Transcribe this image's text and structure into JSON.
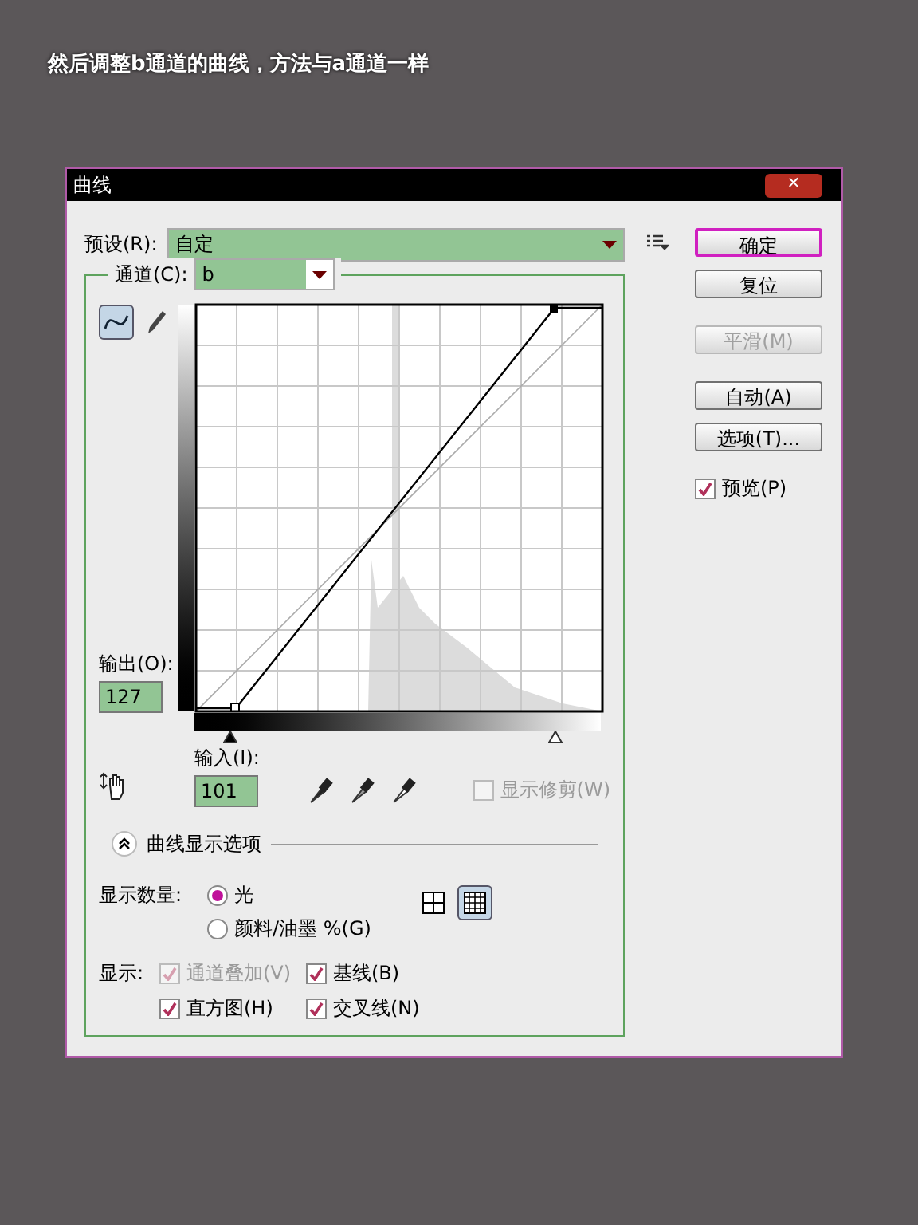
{
  "caption": "然后调整b通道的曲线，方法与a通道一样",
  "dialog": {
    "title": "曲线",
    "close": "✕",
    "preset": {
      "label": "预设(R):",
      "value": "自定"
    },
    "channel": {
      "label": "通道(C):",
      "value": "b"
    },
    "tools": [
      {
        "kind": "curve",
        "selected": true
      },
      {
        "kind": "pencil",
        "selected": false
      }
    ],
    "output": {
      "label": "输出(O):",
      "value": "127"
    },
    "input": {
      "label": "输入(I):",
      "value": "101"
    },
    "input_sliders": [
      {
        "level": 0.09
      },
      {
        "level": 0.89
      }
    ],
    "show_clipping": {
      "label": "显示修剪(W)",
      "checked": false,
      "disabled": true
    },
    "buttons": [
      {
        "label": "确定",
        "primary": true,
        "disabled": false
      },
      {
        "label": "复位",
        "primary": false,
        "disabled": false
      },
      {
        "label": "平滑(M)",
        "primary": false,
        "disabled": true
      },
      {
        "label": "自动(A)",
        "primary": false,
        "disabled": false
      },
      {
        "label": "选项(T)...",
        "primary": false,
        "disabled": false
      }
    ],
    "preview": {
      "label": "预览(P)",
      "checked": true
    },
    "display_options": {
      "title": "曲线显示选项",
      "expanded": true
    },
    "show_amount": {
      "label": "显示数量:",
      "options": [
        {
          "label": "光",
          "selected": true
        },
        {
          "label": "颜料/油墨 %(G)",
          "selected": false
        }
      ]
    },
    "grid_sizes": [
      {
        "kind": "coarse",
        "selected": false
      },
      {
        "kind": "fine",
        "selected": true
      }
    ],
    "show": {
      "label": "显示:",
      "checks": [
        {
          "label": "通道叠加(V)",
          "checked": true,
          "disabled": true
        },
        {
          "label": "基线(B)",
          "checked": true,
          "disabled": false
        },
        {
          "label": "直方图(H)",
          "checked": true,
          "disabled": false
        },
        {
          "label": "交叉线(N)",
          "checked": true,
          "disabled": false
        }
      ]
    }
  }
}
